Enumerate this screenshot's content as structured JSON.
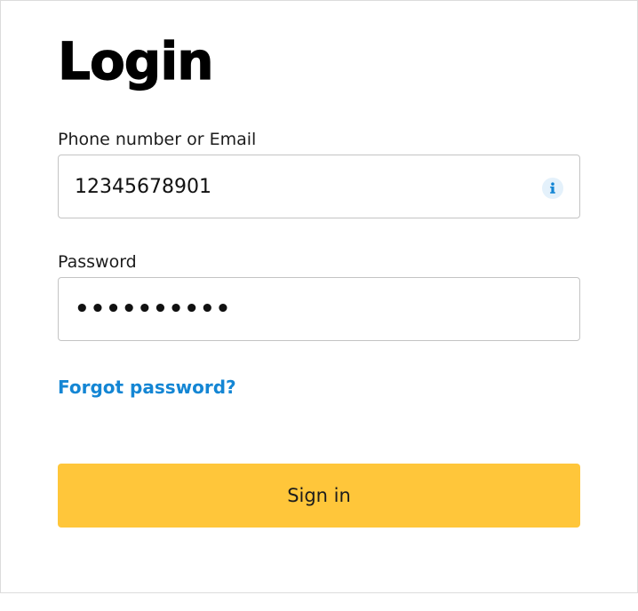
{
  "page": {
    "title": "Login"
  },
  "phone_field": {
    "label": "Phone number or Email",
    "value": "12345678901",
    "icon": "info-icon"
  },
  "password_field": {
    "label": "Password",
    "value": "••••••••••"
  },
  "forgot_link": {
    "label": "Forgot password?"
  },
  "signin_button": {
    "label": "Sign in"
  },
  "colors": {
    "accent": "#ffc63a",
    "link": "#1486d4",
    "border": "#c4c4c4",
    "info_icon": "#1486d4"
  }
}
